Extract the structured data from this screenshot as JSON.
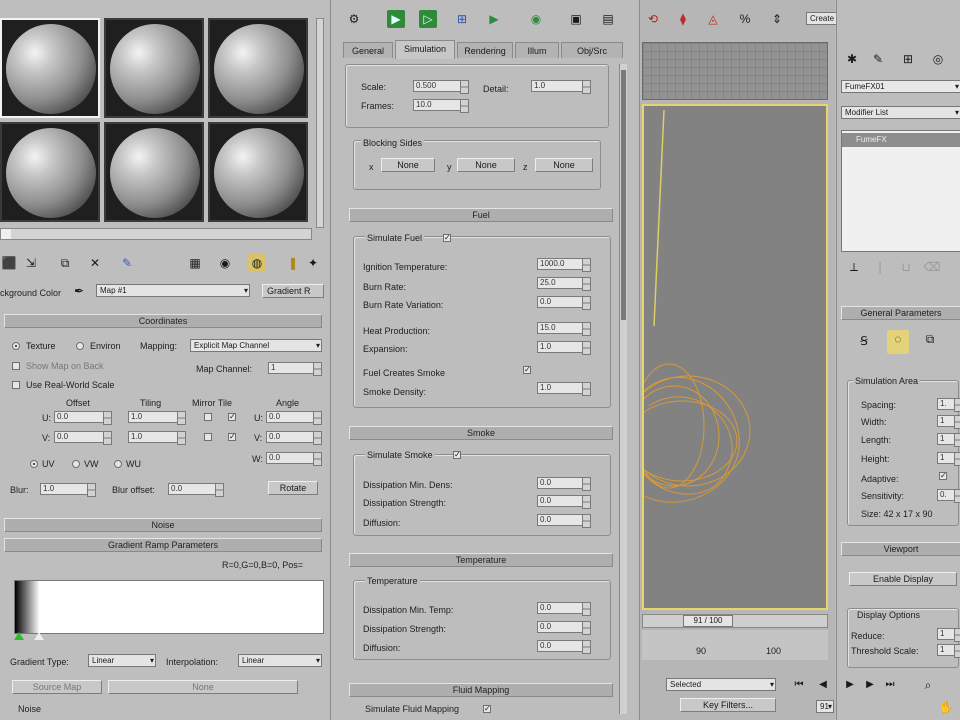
{
  "material_editor": {
    "background_color_label": "ckground Color",
    "map_name": "Map #1",
    "gradient_btn": "Gradient R",
    "coordinates": {
      "rollout": "Coordinates",
      "texture": "Texture",
      "environ": "Environ",
      "mapping_label": "Mapping:",
      "mapping_value": "Explicit Map Channel",
      "show_map_on_back": "Show Map on Back",
      "map_channel_label": "Map Channel:",
      "map_channel_value": "1",
      "use_real_world": "Use Real-World Scale",
      "offset": "Offset",
      "tiling": "Tiling",
      "mirror_tile": "Mirror Tile",
      "angle": "Angle",
      "u": "U:",
      "v": "V:",
      "w": "W:",
      "u_offset": "0.0",
      "v_offset": "0.0",
      "u_tiling": "1.0",
      "v_tiling": "1.0",
      "u_angle": "0.0",
      "v_angle": "0.0",
      "w_angle": "0.0",
      "uv": "UV",
      "vw": "VW",
      "wu": "WU",
      "blur_label": "Blur:",
      "blur_value": "1.0",
      "blur_offset_label": "Blur offset:",
      "blur_offset_value": "0.0",
      "rotate": "Rotate"
    },
    "noise_rollout": "Noise",
    "gradient_ramp_rollout": "Gradient Ramp Parameters",
    "ramp_info": "R=0,G=0,B=0, Pos=",
    "gradient_type_label": "Gradient Type:",
    "gradient_type_value": "Linear",
    "interpolation_label": "Interpolation:",
    "interpolation_value": "Linear",
    "source_map": "Source Map",
    "none_btn": "None",
    "noise_label": "Noise"
  },
  "fluid": {
    "tabs": [
      "General",
      "Simulation",
      "Rendering",
      "Illum",
      "Obj/Src"
    ],
    "scale_label": "Scale:",
    "scale_value": "0.500",
    "detail_label": "Detail:",
    "detail_value": "1.0",
    "frames_label": "Frames:",
    "frames_value": "10.0",
    "blocking_sides": "Blocking Sides",
    "none1": "None",
    "none2": "None",
    "none3": "None",
    "fuel_rollout": "Fuel",
    "simulate_fuel": "Simulate Fuel",
    "ignition_temp_label": "Ignition Temperature:",
    "ignition_temp_value": "1000.0",
    "burn_rate_label": "Burn Rate:",
    "burn_rate_value": "25.0",
    "burn_rate_var_label": "Burn Rate Variation:",
    "burn_rate_var_value": "0.0",
    "heat_production_label": "Heat Production:",
    "heat_production_value": "15.0",
    "expansion_label": "Expansion:",
    "expansion_value": "1.0",
    "fuel_creates_smoke": "Fuel Creates Smoke",
    "smoke_density_label": "Smoke Density:",
    "smoke_density_value": "1.0",
    "smoke_rollout": "Smoke",
    "simulate_smoke": "Simulate Smoke",
    "smoke_diss_min_label": "Dissipation Min. Dens:",
    "smoke_diss_min_value": "0.0",
    "smoke_diss_strength_label": "Dissipation Strength:",
    "smoke_diss_strength_value": "0.0",
    "smoke_diffusion_label": "Diffusion:",
    "smoke_diffusion_value": "0.0",
    "temperature_rollout": "Temperature",
    "temperature_group": "Temperature",
    "temp_diss_min_label": "Dissipation Min. Temp:",
    "temp_diss_min_value": "0.0",
    "temp_diss_strength_label": "Dissipation Strength:",
    "temp_diss_strength_value": "0.0",
    "temp_diffusion_label": "Diffusion:",
    "temp_diffusion_value": "0.0",
    "fluid_mapping_rollout": "Fluid Mapping",
    "simulate_fluid_mapping": "Simulate Fluid Mapping"
  },
  "viewport": {
    "selection_set": "Create Selection Set",
    "frame_counter": "91 / 100",
    "ruler_90": "90",
    "ruler_100": "100",
    "selected_dropdown": "Selected",
    "key_filters": "Key Filters...",
    "frame_field": "91"
  },
  "command_panel": {
    "object_name": "FumeFX01",
    "modifier_list": "Modifier List",
    "stack_item": "FumeFX",
    "general_params_rollout": "General Parameters",
    "simulation_area": "Simulation Area",
    "spacing_label": "Spacing:",
    "spacing_value": "1.",
    "width_label": "Width:",
    "width_value": "1",
    "length_label": "Length:",
    "length_value": "1",
    "height_label": "Height:",
    "height_value": "1",
    "adaptive_label": "Adaptive:",
    "sensitivity_label": "Sensitivity:",
    "sensitivity_value": "0.",
    "size_label": "Size: 42 x 17 x 90",
    "viewport_rollout": "Viewport",
    "enable_display": "Enable Display",
    "display_options": "Display Options",
    "reduce_label": "Reduce:",
    "reduce_value": "1",
    "threshold_label": "Threshold Scale:",
    "threshold_value": "1"
  },
  "colors": {
    "panel_bg": "#bdbdbd",
    "viewport_bg": "#828282",
    "viewport_border": "#e8d56a",
    "simulation_wire": "#d69a3a"
  }
}
